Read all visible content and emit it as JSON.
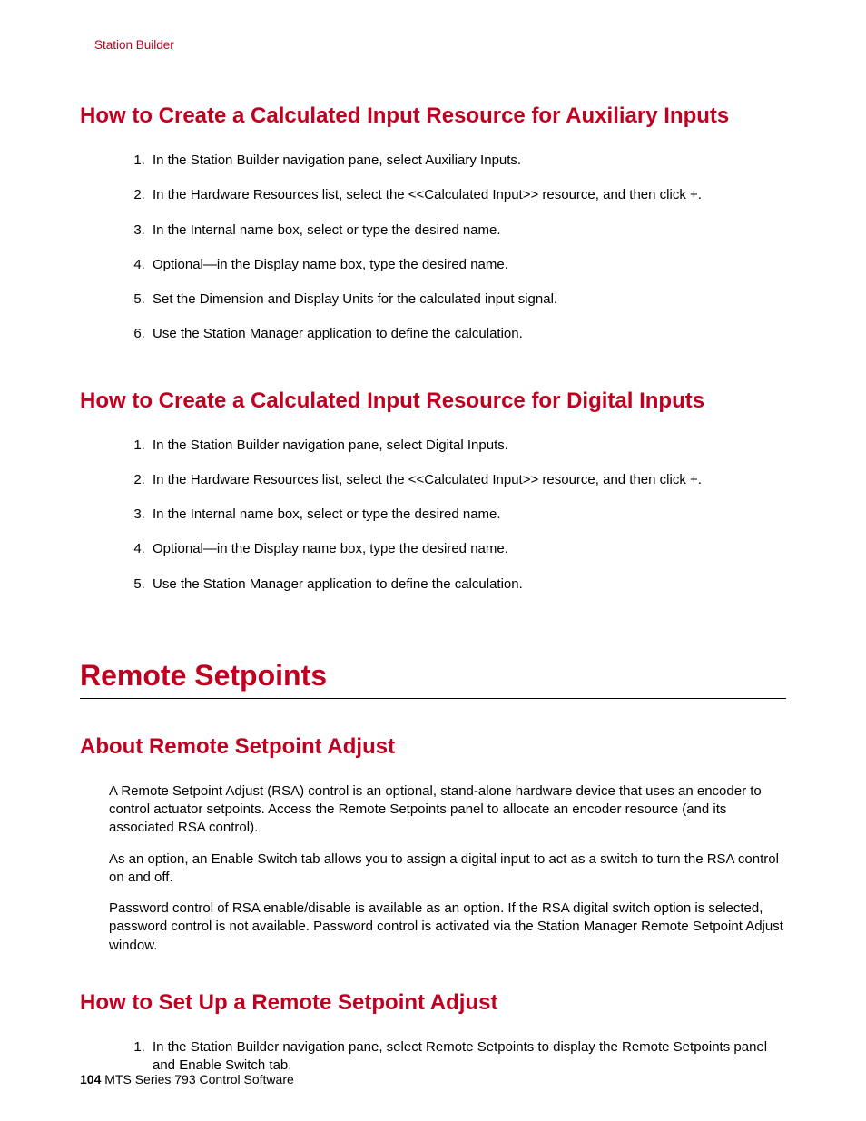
{
  "breadcrumb": "Station Builder",
  "section1": {
    "heading": "How to Create a Calculated Input Resource for Auxiliary Inputs",
    "steps": [
      "In the Station Builder navigation pane, select Auxiliary Inputs.",
      "In the Hardware Resources list, select the <<Calculated Input>> resource, and then click +.",
      "In the Internal name box, select or type the desired name.",
      "Optional—in the Display name box, type the desired name.",
      "Set the Dimension and Display Units for the calculated input signal.",
      "Use the Station Manager application to define the calculation."
    ]
  },
  "section2": {
    "heading": "How to Create a Calculated Input Resource for Digital Inputs",
    "steps": [
      "In the Station Builder navigation pane, select Digital Inputs.",
      "In the Hardware Resources list, select the <<Calculated Input>> resource, and then click +.",
      "In the Internal name box, select or type the desired name.",
      "Optional—in the Display name box, type the desired name.",
      "Use the Station Manager application to define the calculation."
    ]
  },
  "section3": {
    "title": "Remote Setpoints",
    "about": {
      "heading": "About Remote Setpoint Adjust",
      "paras": [
        "A Remote Setpoint Adjust (RSA) control is an optional, stand-alone hardware device that uses an encoder to control actuator setpoints. Access the Remote Setpoints panel to allocate an encoder resource (and its associated RSA control).",
        "As an option, an Enable Switch tab allows you to assign a digital input to act as a switch to turn the RSA control on and off.",
        "Password control of RSA enable/disable is available as an option. If the RSA digital switch option is selected, password control is not available. Password control is activated via the Station Manager Remote Setpoint Adjust window."
      ]
    },
    "howto": {
      "heading": "How to Set Up a Remote Setpoint Adjust",
      "steps": [
        "In the Station Builder navigation pane, select Remote Setpoints to display the Remote Setpoints panel and Enable Switch tab."
      ]
    }
  },
  "footer": {
    "page": "104",
    "doc": "MTS Series 793 Control Software"
  }
}
